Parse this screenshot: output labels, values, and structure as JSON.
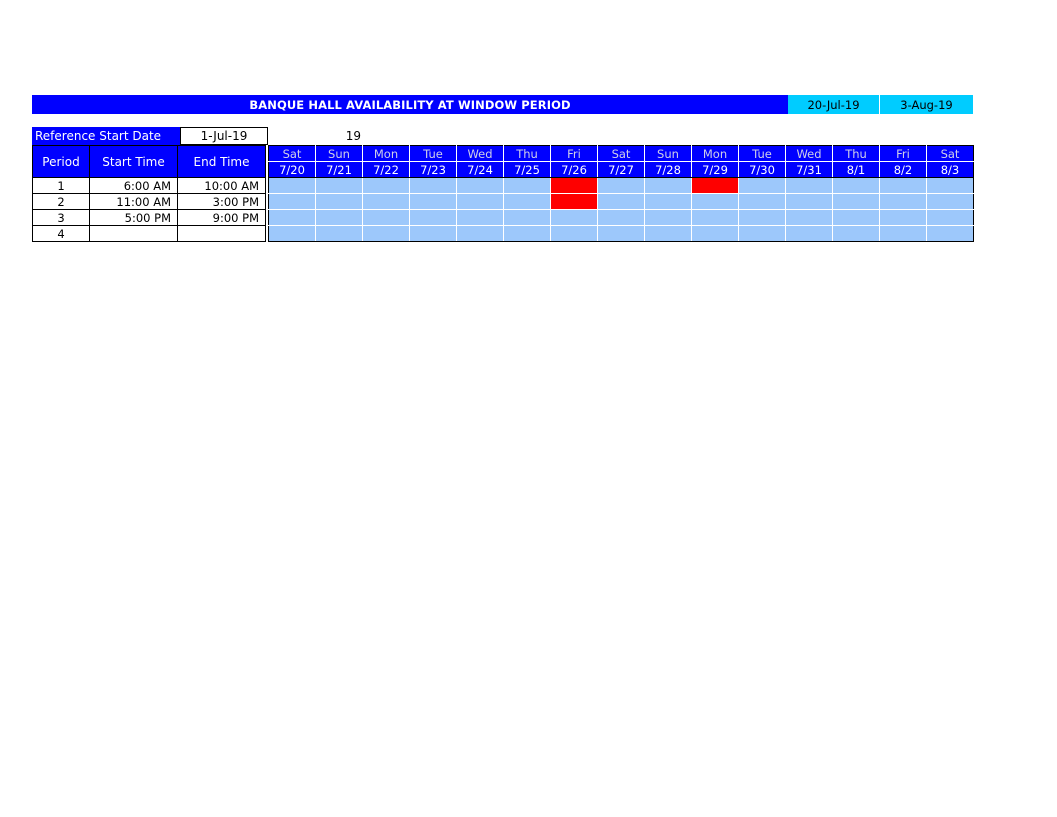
{
  "banner": {
    "title": "BANQUE HALL AVAILABILITY AT WINDOW PERIOD",
    "window_start": "20-Jul-19",
    "window_end": "3-Aug-19",
    "title_bg": "#0000FF",
    "title_fg": "#FFFFFF",
    "window_bg": "#00CCFF"
  },
  "reference": {
    "label": "Reference Start Date",
    "value": "1-Jul-19",
    "count": "19"
  },
  "table": {
    "headers": {
      "period": "Period",
      "start_time": "Start Time",
      "end_time": "End Time"
    },
    "rows": [
      {
        "period": "1",
        "start_time": "6:00 AM",
        "end_time": "10:00 AM"
      },
      {
        "period": "2",
        "start_time": "11:00 AM",
        "end_time": "3:00 PM"
      },
      {
        "period": "3",
        "start_time": "5:00 PM",
        "end_time": "9:00 PM"
      },
      {
        "period": "4",
        "start_time": "",
        "end_time": ""
      }
    ]
  },
  "calendar": {
    "weekdays": [
      "Sat",
      "Sun",
      "Mon",
      "Tue",
      "Wed",
      "Thu",
      "Fri",
      "Sat",
      "Sun",
      "Mon",
      "Tue",
      "Wed",
      "Thu",
      "Fri",
      "Sat"
    ],
    "dates": [
      "7/20",
      "7/21",
      "7/22",
      "7/23",
      "7/24",
      "7/25",
      "7/26",
      "7/27",
      "7/28",
      "7/29",
      "7/30",
      "7/31",
      "8/1",
      "8/2",
      "8/3"
    ],
    "available_color": "#9DC8FB",
    "booked_color": "#FE0000",
    "availability": [
      [
        "free",
        "free",
        "free",
        "free",
        "free",
        "free",
        "booked",
        "free",
        "free",
        "booked",
        "free",
        "free",
        "free",
        "free",
        "free"
      ],
      [
        "free",
        "free",
        "free",
        "free",
        "free",
        "free",
        "booked",
        "free",
        "free",
        "free",
        "free",
        "free",
        "free",
        "free",
        "free"
      ],
      [
        "free",
        "free",
        "free",
        "free",
        "free",
        "free",
        "free",
        "free",
        "free",
        "free",
        "free",
        "free",
        "free",
        "free",
        "free"
      ],
      [
        "free",
        "free",
        "free",
        "free",
        "free",
        "free",
        "free",
        "free",
        "free",
        "free",
        "free",
        "free",
        "free",
        "free",
        "free"
      ]
    ]
  }
}
